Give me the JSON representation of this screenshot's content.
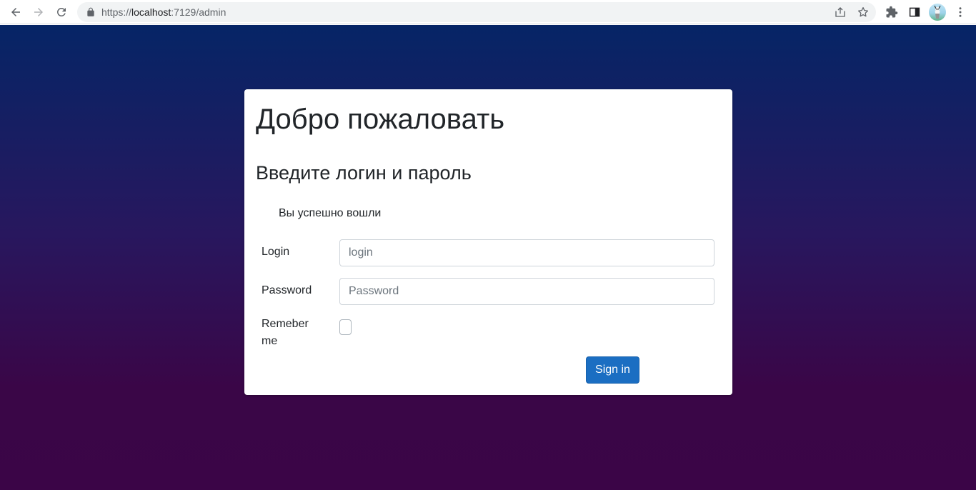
{
  "browser": {
    "url_scheme": "https://",
    "url_host": "localhost",
    "url_path": ":7129/admin",
    "icons": {
      "back": "arrow-left-icon",
      "forward": "arrow-right-icon",
      "reload": "reload-icon",
      "lock": "lock-icon",
      "share": "share-icon",
      "bookmark": "star-icon",
      "extensions": "puzzle-icon",
      "side_panel": "side-panel-icon",
      "menu": "kebab-menu-icon"
    }
  },
  "page": {
    "title": "Добро пожаловать",
    "subtitle": "Введите логин и пароль",
    "status_message": "Вы успешно вошли",
    "form": {
      "login_label": "Login",
      "login_placeholder": "login",
      "login_value": "",
      "password_label": "Password",
      "password_placeholder": "Password",
      "password_value": "",
      "remember_label_line1": "Remeber",
      "remember_label_line2": "me",
      "remember_checked": false,
      "submit_label": "Sign in"
    }
  },
  "colors": {
    "background_top": "#062566",
    "background_bottom": "#3b0547",
    "primary_button": "#1b6ec2"
  }
}
